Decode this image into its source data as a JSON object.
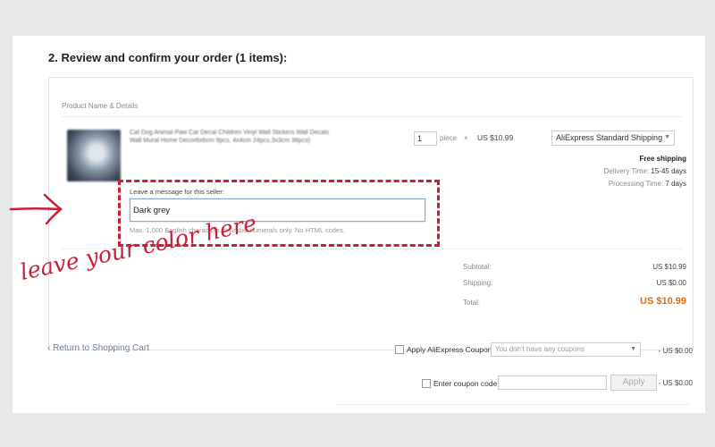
{
  "section_title": "2. Review and confirm your order (1 items):",
  "column_header": "Product Name & Details",
  "product": {
    "name": "Cat Dog Animal Paw Car Decal Children Vinyl Wall Stickers Wall Decals Wall Mural Home Decor6x6cm 9pcs, 4x4cm 24pcs,3x3cm 36pcs)",
    "quantity": "1",
    "unit": "piece",
    "times": "×",
    "unit_price": "US $10.99"
  },
  "shipping": {
    "method": "AliExpress Standard Shipping",
    "free_shipping": "Free shipping",
    "delivery_label": "Delivery Time:",
    "delivery_value": "15-45 days",
    "processing_label": "Processing Time:",
    "processing_value": "7 days"
  },
  "message": {
    "label": "Leave a message for this seller:",
    "value": "Dark grey",
    "hint": "Max. 1,000 English characters or Arabic numerals only. No HTML codes."
  },
  "summary": {
    "subtotal_label": "Subtotal:",
    "subtotal_value": "US $10.99",
    "shipping_label": "Shipping:",
    "shipping_value": "US $0.00",
    "total_label": "Total:",
    "total_value": "US $10.99"
  },
  "return_link": "‹ Return to Shopping Cart",
  "coupon": {
    "label": "Apply AliExpress Coupon:",
    "placeholder": "You don't have any coupons",
    "amount": "- US $0.00"
  },
  "code": {
    "label": "Enter coupon code:",
    "value": "",
    "apply_label": "Apply",
    "amount": "- US $0.00"
  },
  "annotation": {
    "text": "leave your color here",
    "color": "#c91f37"
  },
  "colors": {
    "total_orange": "#e36a0c",
    "link_blue": "#6a7f97"
  }
}
